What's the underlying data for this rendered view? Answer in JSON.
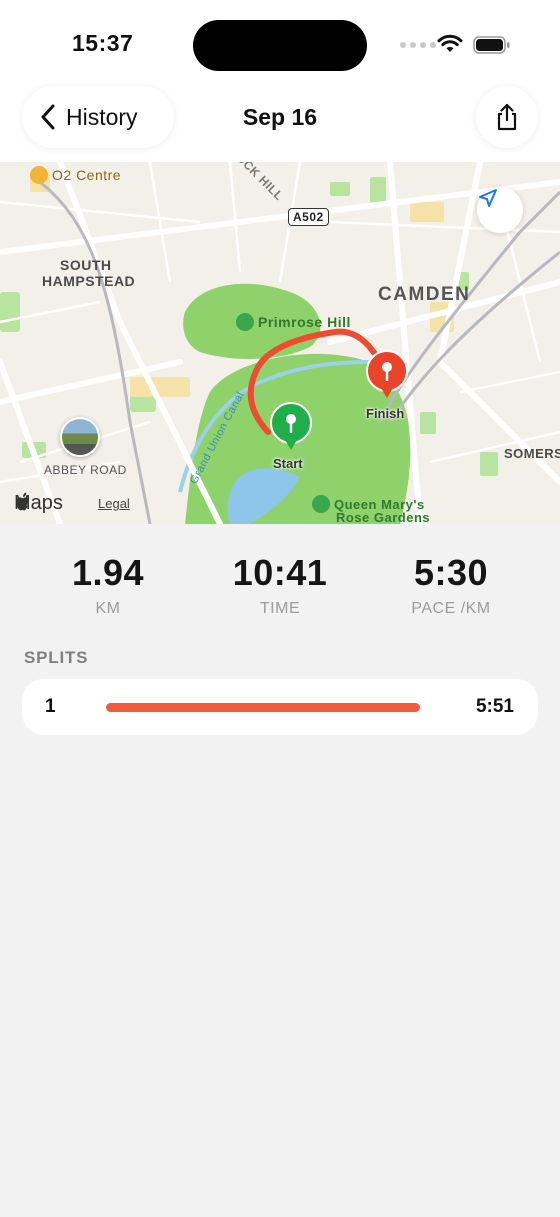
{
  "status_bar": {
    "time": "15:37"
  },
  "nav": {
    "back_label": "History",
    "title": "Sep 16"
  },
  "map": {
    "labels": {
      "o2": "O2 Centre",
      "south": "SOUTH",
      "hampstead": "HAMPSTEAD",
      "camden": "CAMDEN",
      "primrose": "Primrose Hill",
      "road": "A502",
      "street": "UCK HILL",
      "canal": "Grand Union Canal",
      "somers": "SOMERS",
      "abbey": "ABBEY ROAD",
      "queen1": "Queen Mary's",
      "queen2": "Rose Gardens"
    },
    "start_label": "Start",
    "finish_label": "Finish",
    "brand": "Maps",
    "legal": "Legal"
  },
  "stats": {
    "distance": {
      "value": "1.94",
      "label": "KM"
    },
    "time": {
      "value": "10:41",
      "label": "TIME"
    },
    "pace": {
      "value": "5:30",
      "label": "PACE /KM"
    }
  },
  "splits": {
    "header": "SPLITS",
    "rows": [
      {
        "index": "1",
        "pace": "5:51",
        "fill": 1.0
      }
    ]
  },
  "colors": {
    "accent": "#f25a3c",
    "route": "#ee4b31",
    "start_pin": "#1fae4a",
    "finish_pin": "#e8442a",
    "park": "#8fd16a"
  }
}
